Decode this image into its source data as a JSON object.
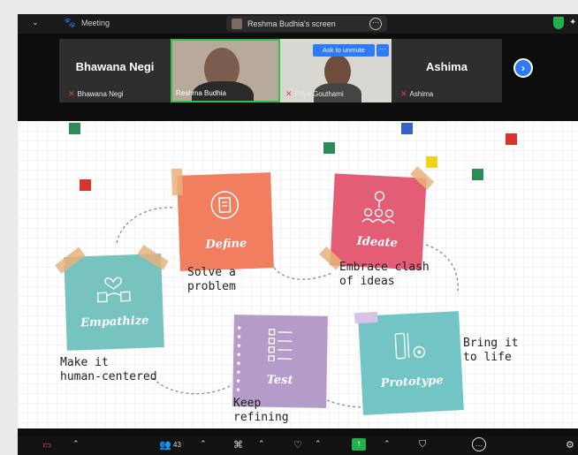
{
  "topbar": {
    "chevron": "⌄",
    "meeting_label": "Meeting",
    "screen_label": "Reshma Budhia's screen",
    "options_glyph": "⋯"
  },
  "participants": {
    "tiles": [
      {
        "big_name": "Bhawana Negi",
        "label": "Bhawana Negi"
      },
      {
        "big_name": "",
        "label": "Reshma Budhia"
      },
      {
        "big_name": "",
        "label": "Priya Gouthami"
      },
      {
        "big_name": "Ashima",
        "label": "Ashima"
      }
    ],
    "ask_to_unmute": "Ask to unmute",
    "ask_more": "···",
    "next": "›"
  },
  "slide": {
    "steps": [
      {
        "title": "Empathize",
        "color": "#77c3c0"
      },
      {
        "title": "Define",
        "color": "#f07e5f"
      },
      {
        "title": "Ideate",
        "color": "#e35d75"
      },
      {
        "title": "Test",
        "color": "#b59bc8"
      },
      {
        "title": "Prototype",
        "color": "#72c4c5"
      }
    ],
    "captions": {
      "define": "Solve a\nproblem",
      "ideate": "Embrace clash\nof ideas",
      "prototype": "Bring it\nto life",
      "test": "Keep\nrefining",
      "empathize": "Make it\nhuman-centered"
    }
  },
  "toolbar": {
    "participants_count": "43",
    "caret": "⌃"
  }
}
